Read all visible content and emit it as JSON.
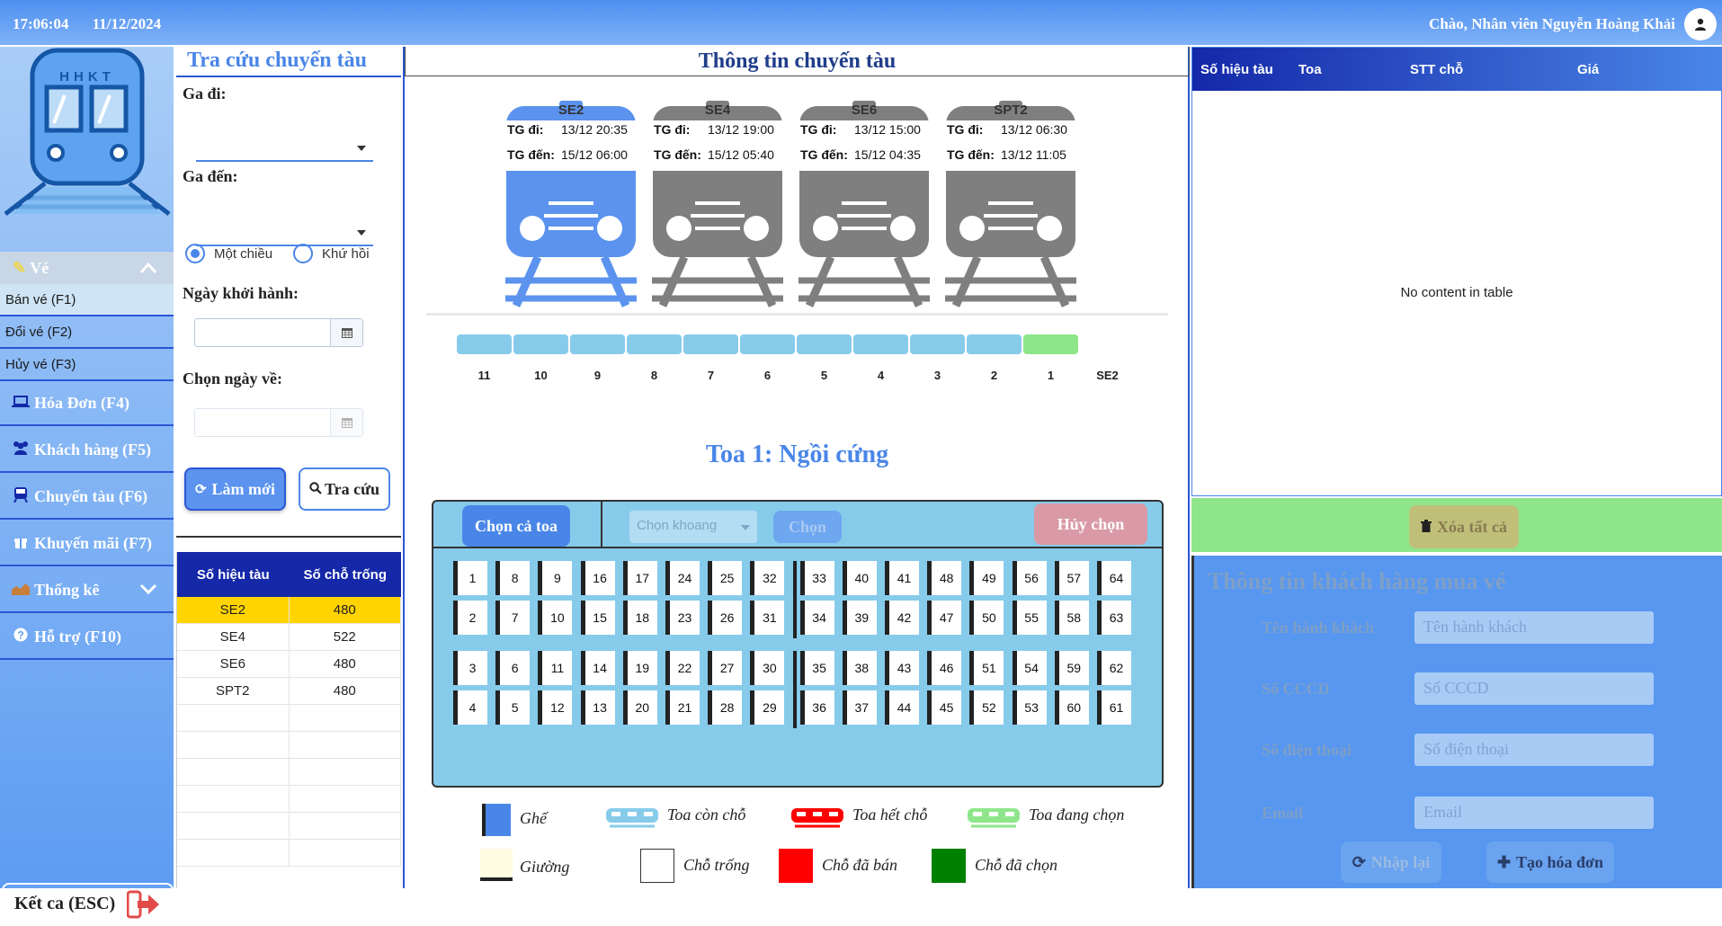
{
  "header": {
    "time": "17:06:04",
    "date": "11/12/2024",
    "greeting": "Chào, Nhân viên Nguyễn Hoàng Khải",
    "avatar_icon": "user-icon"
  },
  "sidebar": {
    "logo_text": "HHKT",
    "ve_label": "Vé",
    "sub_items": [
      "Bán vé (F1)",
      "Đổi vé (F2)",
      "Hủy vé (F3)"
    ],
    "items": [
      {
        "label": "Hóa Đơn (F4)",
        "icon": "laptop-icon"
      },
      {
        "label": "Khách hàng (F5)",
        "icon": "users-icon"
      },
      {
        "label": "Chuyến tàu (F6)",
        "icon": "train-icon"
      },
      {
        "label": "Khuyến mãi (F7)",
        "icon": "gift-icon"
      },
      {
        "label": "Thống kê",
        "icon": "chart-icon"
      },
      {
        "label": "Hỗ trợ (F10)",
        "icon": "help-icon"
      }
    ],
    "logout_label": "Kết ca (ESC)"
  },
  "search": {
    "title": "Tra cứu chuyến tàu",
    "ga_di_label": "Ga đi:",
    "ga_den_label": "Ga đến:",
    "ga_di_value": "",
    "ga_den_value": "",
    "radio_one_way": "Một chiều",
    "radio_round": "Khứ hồi",
    "ngay_khoi_hanh_label": "Ngày khởi hành:",
    "chon_ngay_ve_label": "Chọn ngày về:",
    "ngay_khoi_hanh_value": "",
    "ngay_ve_value": "",
    "btn_lam_moi": "Làm mới",
    "btn_tra_cuu": "Tra cứu",
    "table": {
      "headers": [
        "Số hiệu tàu",
        "Số chỗ trống"
      ],
      "rows": [
        [
          "SE2",
          "480"
        ],
        [
          "SE4",
          "522"
        ],
        [
          "SE6",
          "480"
        ],
        [
          "SPT2",
          "480"
        ]
      ]
    }
  },
  "center": {
    "title": "Thông tin chuyến tàu",
    "tg_di_label": "TG đi:",
    "tg_den_label": "TG đến:",
    "trains": [
      {
        "name": "SE2",
        "tg_di": "13/12 20:35",
        "tg_den": "15/12 06:00",
        "color": "#5b93ee"
      },
      {
        "name": "SE4",
        "tg_di": "13/12 19:00",
        "tg_den": "15/12 05:40",
        "color": "#7f7f7f"
      },
      {
        "name": "SE6",
        "tg_di": "13/12 15:00",
        "tg_den": "15/12 04:35",
        "color": "#7f7f7f"
      },
      {
        "name": "SPT2",
        "tg_di": "13/12 06:30",
        "tg_den": "13/12 11:05",
        "color": "#7f7f7f"
      }
    ],
    "cars": [
      "11",
      "10",
      "9",
      "8",
      "7",
      "6",
      "5",
      "4",
      "3",
      "2",
      "1"
    ],
    "selected_car": "1",
    "train_label": "SE2",
    "toa_title": "Toa 1: Ngồi cứng",
    "btn_chon_ca_toa": "Chọn cả toa",
    "chon_khoang_placeholder": "Chọn khoang",
    "btn_chon": "Chọn",
    "btn_huy_chon": "Hủy chọn",
    "seat_rows": [
      [
        "1",
        "8",
        "9",
        "16",
        "17",
        "24",
        "25",
        "32",
        "33",
        "40",
        "41",
        "48",
        "49",
        "56",
        "57",
        "64"
      ],
      [
        "2",
        "7",
        "10",
        "15",
        "18",
        "23",
        "26",
        "31",
        "34",
        "39",
        "42",
        "47",
        "50",
        "55",
        "58",
        "63"
      ],
      [
        "3",
        "6",
        "11",
        "14",
        "19",
        "22",
        "27",
        "30",
        "35",
        "38",
        "43",
        "46",
        "51",
        "54",
        "59",
        "62"
      ],
      [
        "4",
        "5",
        "12",
        "13",
        "20",
        "21",
        "28",
        "29",
        "36",
        "37",
        "44",
        "45",
        "52",
        "53",
        "60",
        "61"
      ]
    ],
    "legend": {
      "ghe": "Ghế",
      "toa_con_cho": "Toa còn chỗ",
      "toa_het_cho": "Toa hết chỗ",
      "toa_dang_chon": "Toa đang chọn",
      "giuong": "Giường",
      "cho_trong": "Chỗ trống",
      "cho_da_ban": "Chỗ đã bán",
      "cho_da_chon": "Chỗ đã chọn"
    },
    "colors": {
      "car_available": "#87cbeb",
      "car_full": "#ff0000",
      "car_selected": "#8fe68a",
      "sold": "#ff0000",
      "chosen": "#008000"
    }
  },
  "cart": {
    "headers": [
      "Số hiệu tàu",
      "Toa",
      "STT chỗ",
      "Giá"
    ],
    "empty_text": "No content in table",
    "btn_xoa_tat_ca": "Xóa tất cả"
  },
  "customer": {
    "title": "Thông tin khách hàng mua vé",
    "fields": [
      {
        "label": "Tên hành khách",
        "placeholder": "Tên hành khách"
      },
      {
        "label": "Số CCCD",
        "placeholder": "Số CCCD"
      },
      {
        "label": "Số điện thoại",
        "placeholder": "Số điện thoại"
      },
      {
        "label": "Email",
        "placeholder": "Email"
      }
    ],
    "btn_nhap_lai": "Nhập lại",
    "btn_tao_hoa_don": "Tạo hóa đơn"
  }
}
